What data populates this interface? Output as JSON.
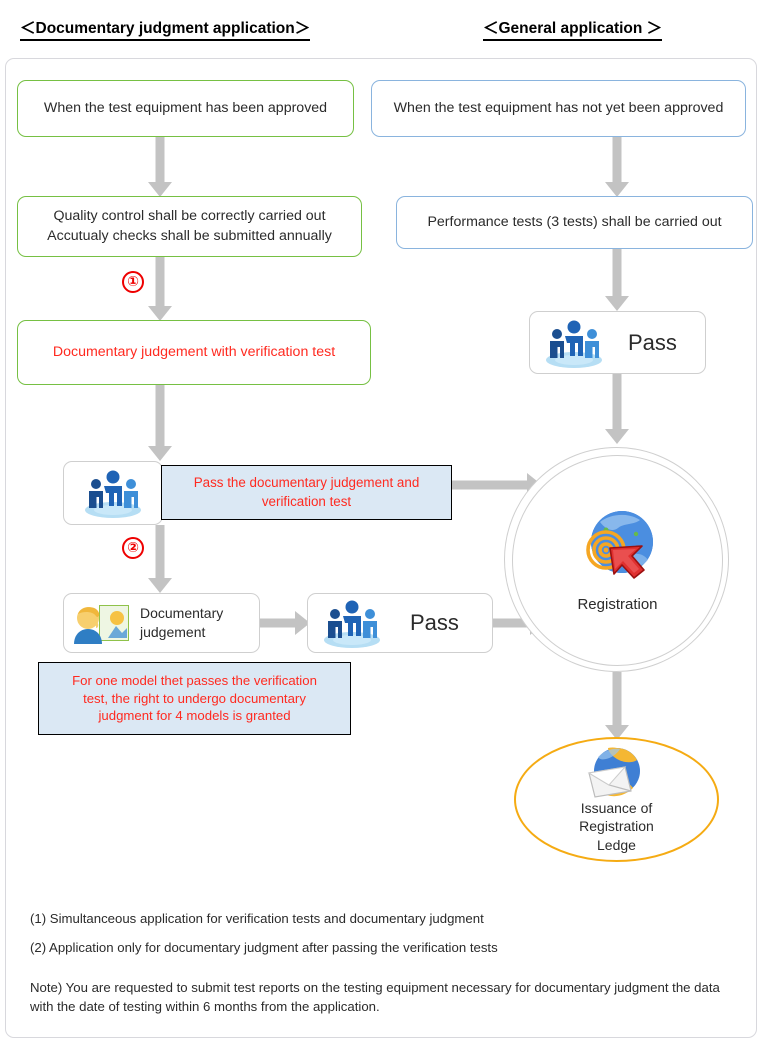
{
  "headers": {
    "left": "＜Documentary judgment application＞",
    "right": "＜General application ＞"
  },
  "left_column": {
    "step1": "When the test equipment has been approved",
    "step2_line1": "Quality control shall be correctly carried out",
    "step2_line2": "Accutualy checks shall be submitted annually",
    "marker1": "①",
    "step3": "Documentary judgement with verification test",
    "marker2": "②",
    "pass_callout_line1": "Pass the documentary judgement and",
    "pass_callout_line2": "verification test",
    "doc_judgement_line1": "Documentary",
    "doc_judgement_line2": "judgement",
    "pass_label": "Pass",
    "blue_note_line1": "For one model thet passes the verification",
    "blue_note_line2": "test, the right to undergo documentary",
    "blue_note_line3": "judgment for 4 models is granted"
  },
  "right_column": {
    "step1": "When the test equipment has not yet been approved",
    "step2": "Performance tests (3 tests) shall be carried out",
    "pass_label": "Pass",
    "registration_label": "Registration",
    "issuance_line1": "Issuance of",
    "issuance_line2": "Registration",
    "issuance_line3": "Ledge"
  },
  "notes": {
    "note1": "(1) Simultanceous application for verification tests and documentary judgment",
    "note2": "(2) Application only for documentary judgment after passing the verification tests",
    "note3_line1": "Note)  You are requested to submit test reports on the testing equipment necessary for documentary",
    "note3_line2": "judgment the data with the date of testing within 6 months from the application."
  },
  "colors": {
    "green_border": "#76c043",
    "blue_border": "#8ab4de",
    "red_text": "#ff2a20",
    "callout_bg": "#dbe8f4",
    "arrow_grey": "#c3c3c3",
    "issuance_border": "#f5ab13"
  },
  "icons": {
    "people": "people-group-icon",
    "document_judgement": "document-review-icon",
    "globe_arrow": "globe-cursor-icon",
    "envelope_globe": "envelope-globe-icon"
  }
}
